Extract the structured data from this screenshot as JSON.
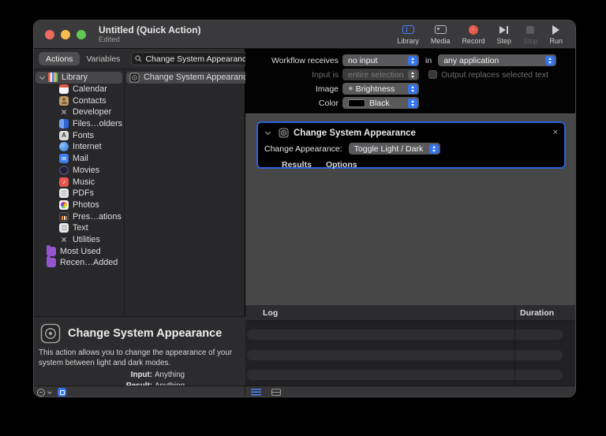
{
  "titlebar": {
    "title": "Untitled (Quick Action)",
    "status": "Edited"
  },
  "toolbar": {
    "library": "Library",
    "media": "Media",
    "record": "Record",
    "step": "Step",
    "stop": "Stop",
    "run": "Run"
  },
  "library_pane": {
    "actions_tab": "Actions",
    "variables_tab": "Variables",
    "search_value": "Change System Appearance",
    "items": [
      {
        "label": "Library"
      },
      {
        "label": "Calendar"
      },
      {
        "label": "Contacts"
      },
      {
        "label": "Developer"
      },
      {
        "label": "Files…olders"
      },
      {
        "label": "Fonts"
      },
      {
        "label": "Internet"
      },
      {
        "label": "Mail"
      },
      {
        "label": "Movies"
      },
      {
        "label": "Music"
      },
      {
        "label": "PDFs"
      },
      {
        "label": "Photos"
      },
      {
        "label": "Pres…ations"
      },
      {
        "label": "Text"
      },
      {
        "label": "Utilities"
      },
      {
        "label": "Most Used"
      },
      {
        "label": "Recen…Added"
      }
    ],
    "result_item": "Change System Appearance"
  },
  "options_panel": {
    "workflow_receives_label": "Workflow receives",
    "workflow_receives_value": "no input",
    "in_label": "in",
    "in_value": "any application",
    "input_is_label": "Input is",
    "input_is_value": "entire selection",
    "output_checkbox_label": "Output replaces selected text",
    "image_label": "Image",
    "image_value": "Brightness",
    "color_label": "Color",
    "color_value": "Black"
  },
  "action_block": {
    "title": "Change System Appearance",
    "close": "×",
    "appearance_label": "Change Appearance:",
    "appearance_value": "Toggle Light / Dark",
    "results_tab": "Results",
    "options_tab": "Options"
  },
  "description_panel": {
    "title": "Change System Appearance",
    "body": "This action allows you to change the appearance of your system between light and dark modes.",
    "input_label": "Input:",
    "input_value": "Anything",
    "result_label": "Result:",
    "result_value": "Anything"
  },
  "log_panel": {
    "log_header": "Log",
    "duration_header": "Duration"
  },
  "colors": {
    "accent_blue": "#3574f0",
    "selection_border": "#2e62d8",
    "record_red": "#df5146",
    "canvas_gray": "#474747",
    "folder_purple": "#9356cf"
  }
}
